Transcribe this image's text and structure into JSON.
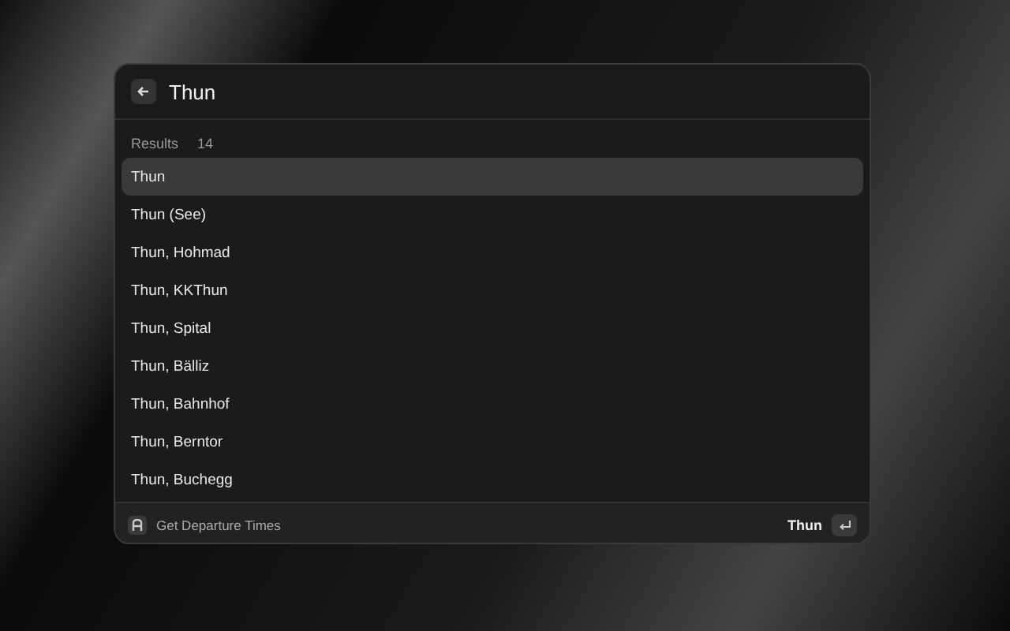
{
  "search": {
    "value": "Thun"
  },
  "results": {
    "label": "Results",
    "count": "14",
    "items": [
      {
        "label": "Thun",
        "selected": true
      },
      {
        "label": "Thun (See)",
        "selected": false
      },
      {
        "label": "Thun, Hohmad",
        "selected": false
      },
      {
        "label": "Thun, KKThun",
        "selected": false
      },
      {
        "label": "Thun, Spital",
        "selected": false
      },
      {
        "label": "Thun, Bälliz",
        "selected": false
      },
      {
        "label": "Thun, Bahnhof",
        "selected": false
      },
      {
        "label": "Thun, Berntor",
        "selected": false
      },
      {
        "label": "Thun, Buchegg",
        "selected": false
      }
    ]
  },
  "footer": {
    "action": "Get Departure Times",
    "primary": "Thun"
  }
}
